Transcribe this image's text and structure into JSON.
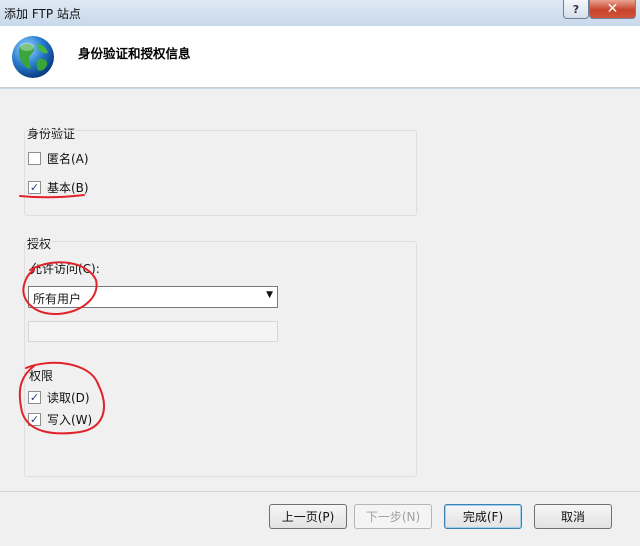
{
  "window": {
    "title": "添加 FTP 站点",
    "help_glyph": "?",
    "close_glyph": "✕"
  },
  "header": {
    "title": "身份验证和授权信息",
    "icon": "globe-icon"
  },
  "authentication": {
    "group_label": "身份验证",
    "anonymous": {
      "label": "匿名(A)",
      "checked": false
    },
    "basic": {
      "label": "基本(B)",
      "checked": true
    }
  },
  "authorization": {
    "group_label": "授权",
    "allow_access_label": "允许访问(C):",
    "allow_access_value": "所有用户",
    "allow_access_field_value": "",
    "permissions_label": "权限",
    "read": {
      "label": "读取(D)",
      "checked": true
    },
    "write": {
      "label": "写入(W)",
      "checked": true
    }
  },
  "footer": {
    "prev_label": "上一页(P)",
    "next_label": "下一步(N)",
    "finish_label": "完成(F)",
    "cancel_label": "取消"
  },
  "glyphs": {
    "check": "✓",
    "dropdown": "▼"
  },
  "colors": {
    "annotation_red": "#e0232b",
    "titlebar": "#c8d8eb",
    "close_button": "#c7432b"
  }
}
